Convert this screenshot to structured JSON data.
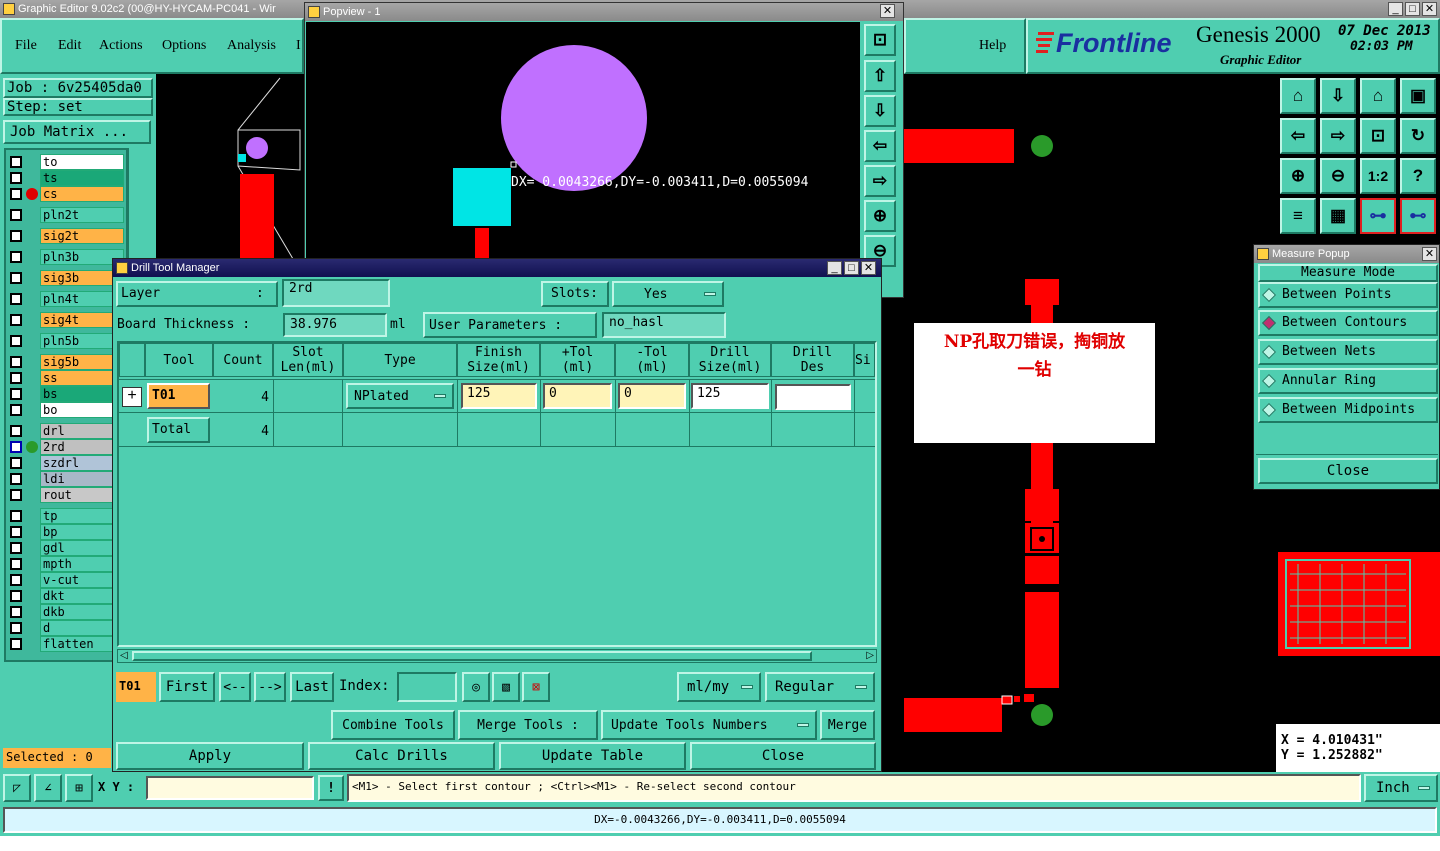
{
  "main_window": {
    "title": "Graphic Editor 9.02c2 (00@HY-HYCAM-PC041 - Wir"
  },
  "menu": [
    "File",
    "Edit",
    "Actions",
    "Options",
    "Analysis",
    "I",
    "Help"
  ],
  "branding": {
    "logo": "Frontline",
    "product": "Genesis 2000",
    "subtitle": "Graphic Editor",
    "date": "07 Dec 2013",
    "time": "02:03 PM"
  },
  "job": {
    "job_label": "Job : 6v25405da0",
    "step_label": "Step: set",
    "matrix_button": "Job Matrix ..."
  },
  "layers": [
    {
      "name": "to",
      "bg": "#ffffff"
    },
    {
      "name": "ts",
      "bg": "#1aa878"
    },
    {
      "name": "cs",
      "bg": "#ffb347"
    },
    {
      "name": "pln2t",
      "bg": "#4fceb0"
    },
    {
      "name": "sig2t",
      "bg": "#ffb347"
    },
    {
      "name": "pln3b",
      "bg": "#4fceb0"
    },
    {
      "name": "sig3b",
      "bg": "#ffb347"
    },
    {
      "name": "pln4t",
      "bg": "#4fceb0"
    },
    {
      "name": "sig4t",
      "bg": "#ffb347"
    },
    {
      "name": "pln5b",
      "bg": "#4fceb0"
    },
    {
      "name": "sig5b",
      "bg": "#ffb347"
    },
    {
      "name": "ss",
      "bg": "#ffb347"
    },
    {
      "name": "bs",
      "bg": "#1aa878"
    },
    {
      "name": "bo",
      "bg": "#ffffff"
    },
    {
      "name": "drl",
      "bg": "#c0c0c0"
    },
    {
      "name": "2rd",
      "bg": "#c0c0c0"
    },
    {
      "name": "szdrl",
      "bg": "#b0c4d8"
    },
    {
      "name": "ldi",
      "bg": "#a8b8c8"
    },
    {
      "name": "rout",
      "bg": "#c8c8c8"
    },
    {
      "name": "tp",
      "bg": "#4fceb0"
    },
    {
      "name": "bp",
      "bg": "#4fceb0"
    },
    {
      "name": "gdl",
      "bg": "#4fceb0"
    },
    {
      "name": "mpth",
      "bg": "#4fceb0"
    },
    {
      "name": "v-cut",
      "bg": "#4fceb0"
    },
    {
      "name": "dkt",
      "bg": "#4fceb0"
    },
    {
      "name": "dkb",
      "bg": "#4fceb0"
    },
    {
      "name": "d",
      "bg": "#4fceb0"
    },
    {
      "name": "flatten",
      "bg": "#4fceb0"
    }
  ],
  "selected": "Selected : 0",
  "popview": {
    "title": "Popview - 1",
    "measure_text": "DX= 0.0043266,DY=-0.003411,D=0.0055094"
  },
  "drill_tool_manager": {
    "title": "Drill Tool Manager",
    "layer_label": "Layer",
    "layer_colon": ":",
    "layer_value": "2rd",
    "slots_label": "Slots:",
    "slots_value": "Yes",
    "board_thickness_label": "Board Thickness :",
    "board_thickness_value": "38.976",
    "board_thickness_unit": "ml",
    "user_params_label": "User Parameters :",
    "user_params_value": "no_hasl",
    "columns": [
      "Tool",
      "Count",
      "Slot\nLen(ml)",
      "Type",
      "Finish\nSize(ml)",
      "+Tol\n(ml)",
      "-Tol\n(ml)",
      "Drill\nSize(ml)",
      "Drill\nDes",
      "Si"
    ],
    "row": {
      "tool": "T01",
      "count": "4",
      "type": "NPlated",
      "finish": "125",
      "ptol": "0",
      "mtol": "0",
      "drill": "125",
      "des": ""
    },
    "total": {
      "label": "Total",
      "count": "4"
    },
    "nav": {
      "current": "T01",
      "first": "First",
      "prev": "<--",
      "next": "-->",
      "last": "Last",
      "index_label": "Index:",
      "units": "ml/my",
      "mode": "Regular"
    },
    "actions": {
      "combine": "Combine Tools",
      "merge_tools": "Merge Tools :",
      "update_numbers": "Update Tools Numbers",
      "merge": "Merge"
    },
    "bottom": {
      "apply": "Apply",
      "calc": "Calc Drills",
      "update": "Update Table",
      "close": "Close"
    }
  },
  "annotation": {
    "line1": "NP孔取刀错误，掏铜放",
    "line2": "一钻"
  },
  "measure_popup": {
    "title": "Measure Popup",
    "header": "Measure Mode",
    "items": [
      "Between Points",
      "Between Contours",
      "Between Nets",
      "Annular Ring",
      "Between Midpoints"
    ],
    "selected_index": 1,
    "close": "Close"
  },
  "coords": {
    "x": "X = 4.010431\"",
    "y": "Y = 1.252882\""
  },
  "status_bar": {
    "xy_label": "X Y :",
    "hint": "<M1> - Select first contour ; <Ctrl><M1> - Re-select second contour",
    "units": "Inch",
    "bottom": "DX=-0.0043266,DY=-0.003411,D=0.0055094"
  },
  "colors": {
    "panel": "#4fceb0",
    "canvas": "#000000",
    "copper": "#ff0000",
    "pad_green": "#2a9a2a",
    "hole": "#c070ff",
    "cyan": "#00e5e5"
  }
}
